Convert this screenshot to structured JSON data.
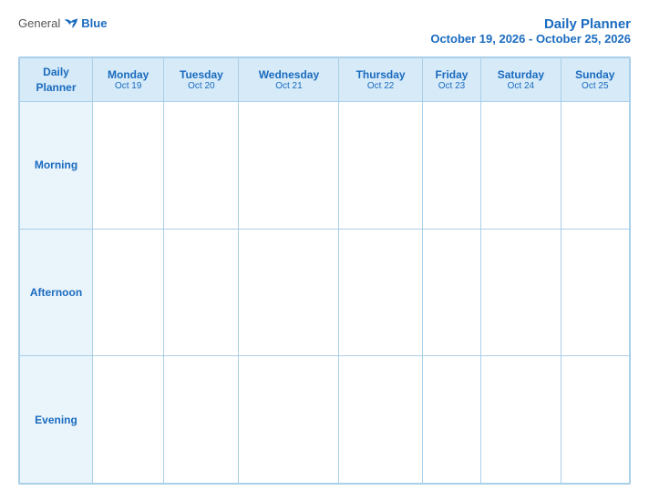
{
  "header": {
    "logo_general": "General",
    "logo_blue": "Blue",
    "title_line1": "Daily Planner",
    "title_line2": "October 19, 2026 - October 25, 2026"
  },
  "columns": [
    {
      "day": "Daily\nPlanner",
      "date": "",
      "is_label": true
    },
    {
      "day": "Monday",
      "date": "Oct 19"
    },
    {
      "day": "Tuesday",
      "date": "Oct 20"
    },
    {
      "day": "Wednesday",
      "date": "Oct 21"
    },
    {
      "day": "Thursday",
      "date": "Oct 22"
    },
    {
      "day": "Friday",
      "date": "Oct 23"
    },
    {
      "day": "Saturday",
      "date": "Oct 24"
    },
    {
      "day": "Sunday",
      "date": "Oct 25"
    }
  ],
  "rows": [
    {
      "label": "Morning"
    },
    {
      "label": "Afternoon"
    },
    {
      "label": "Evening"
    }
  ]
}
